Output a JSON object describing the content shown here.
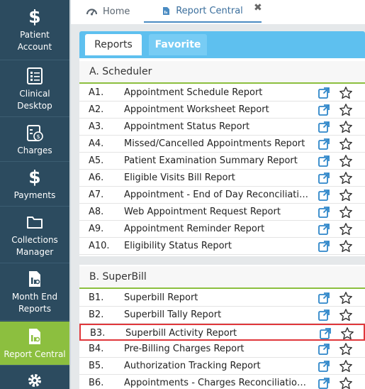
{
  "sidebar": {
    "items": [
      {
        "label_line1": "Patient",
        "label_line2": "Account",
        "icon": "dollar-icon"
      },
      {
        "label_line1": "Clinical",
        "label_line2": "Desktop",
        "icon": "clipboard-icon"
      },
      {
        "label_line1": "Charges",
        "label_line2": "",
        "icon": "charges-icon"
      },
      {
        "label_line1": "Payments",
        "label_line2": "",
        "icon": "dollar-icon"
      },
      {
        "label_line1": "Collections",
        "label_line2": "Manager",
        "icon": "folder-icon"
      },
      {
        "label_line1": "Month End",
        "label_line2": "Reports",
        "icon": "report-file-icon"
      },
      {
        "label_line1": "Report Central",
        "label_line2": "",
        "icon": "report-file-icon"
      }
    ],
    "active_index": 6,
    "colors": {
      "bg": "#2c4b5f",
      "active": "#8cbf3f"
    }
  },
  "top_tabs": {
    "home": "Home",
    "report_central": "Report Central",
    "close": "✖"
  },
  "panel_tabs": {
    "reports": "Reports",
    "favorite": "Favorite"
  },
  "sections": [
    {
      "title": "A. Scheduler",
      "rows": [
        {
          "num": "A1.",
          "name": "Appointment Schedule Report"
        },
        {
          "num": "A2.",
          "name": "Appointment Worksheet Report"
        },
        {
          "num": "A3.",
          "name": "Appointment Status Report"
        },
        {
          "num": "A4.",
          "name": "Missed/Cancelled Appointments Report"
        },
        {
          "num": "A5.",
          "name": "Patient Examination Summary Report"
        },
        {
          "num": "A6.",
          "name": "Eligible Visits Bill Report"
        },
        {
          "num": "A7.",
          "name": "Appointment - End of Day Reconciliation ..."
        },
        {
          "num": "A8.",
          "name": "Web Appointment Request Report"
        },
        {
          "num": "A9.",
          "name": "Appointment Reminder Report"
        },
        {
          "num": "A10.",
          "name": "Eligibility Status Report"
        }
      ]
    },
    {
      "title": "B. SuperBill",
      "rows": [
        {
          "num": "B1.",
          "name": "Superbill Report"
        },
        {
          "num": "B2.",
          "name": "Superbill Tally Report"
        },
        {
          "num": "B3.",
          "name": "Superbill Activity Report"
        },
        {
          "num": "B4.",
          "name": "Pre-Billing Charges Report"
        },
        {
          "num": "B5.",
          "name": "Authorization Tracking Report"
        },
        {
          "num": "B6.",
          "name": "Appointments - Charges Reconciliation R..."
        }
      ]
    }
  ],
  "highlighted_row": "B3."
}
